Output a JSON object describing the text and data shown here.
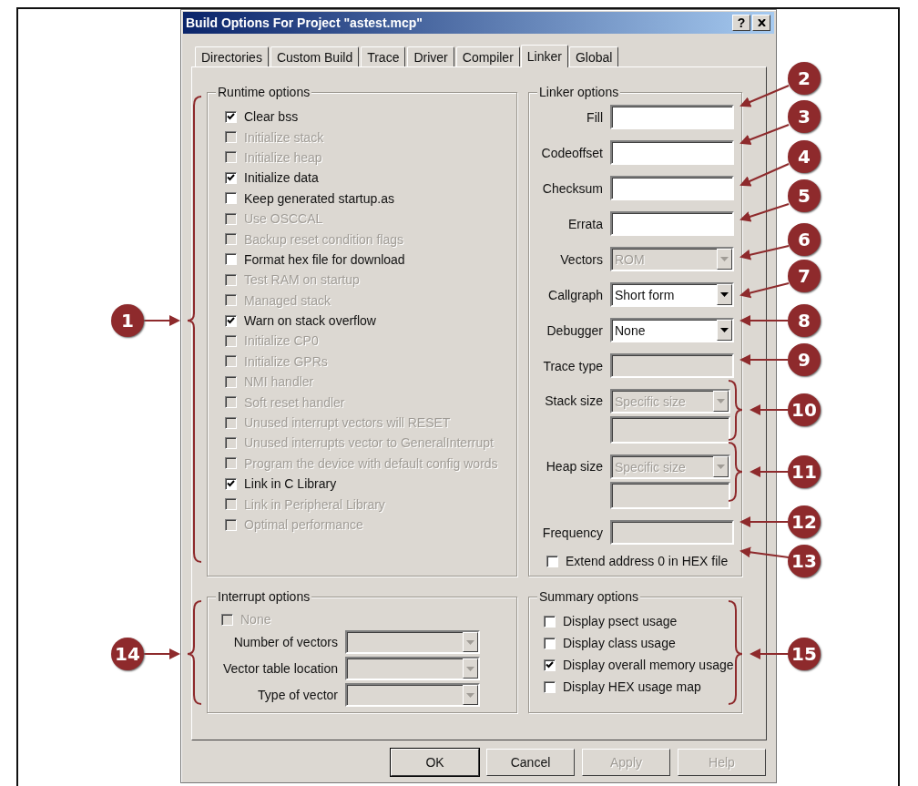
{
  "window": {
    "title": "Build Options For Project \"astest.mcp\"",
    "help_button": "?"
  },
  "tabs": [
    {
      "label": "Directories",
      "selected": false
    },
    {
      "label": "Custom Build",
      "selected": false
    },
    {
      "label": "Trace",
      "selected": false
    },
    {
      "label": "Driver",
      "selected": false
    },
    {
      "label": "Compiler",
      "selected": false
    },
    {
      "label": "Linker",
      "selected": true
    },
    {
      "label": "Global",
      "selected": false
    }
  ],
  "runtime_options": {
    "title": "Runtime options",
    "items": [
      {
        "label": "Clear bss",
        "checked": true,
        "disabled": false
      },
      {
        "label": "Initialize stack",
        "checked": false,
        "disabled": true
      },
      {
        "label": "Initialize heap",
        "checked": false,
        "disabled": true
      },
      {
        "label": "Initialize data",
        "checked": true,
        "disabled": false
      },
      {
        "label": "Keep generated startup.as",
        "checked": false,
        "disabled": false
      },
      {
        "label": "Use OSCCAL",
        "checked": false,
        "disabled": true
      },
      {
        "label": "Backup reset condition flags",
        "checked": false,
        "disabled": true
      },
      {
        "label": "Format hex file for download",
        "checked": false,
        "disabled": false
      },
      {
        "label": "Test RAM on startup",
        "checked": false,
        "disabled": true
      },
      {
        "label": "Managed stack",
        "checked": false,
        "disabled": true
      },
      {
        "label": "Warn on stack overflow",
        "checked": true,
        "disabled": false
      },
      {
        "label": "Initialize CP0",
        "checked": false,
        "disabled": true
      },
      {
        "label": "Initialize GPRs",
        "checked": false,
        "disabled": true
      },
      {
        "label": "NMI handler",
        "checked": false,
        "disabled": true
      },
      {
        "label": "Soft reset handler",
        "checked": false,
        "disabled": true
      },
      {
        "label": "Unused interrupt vectors will RESET",
        "checked": false,
        "disabled": true
      },
      {
        "label": "Unused interrupts vector to GeneralInterrupt",
        "checked": false,
        "disabled": true
      },
      {
        "label": "Program the device with default config words",
        "checked": false,
        "disabled": true
      },
      {
        "label": "Link in C Library",
        "checked": true,
        "disabled": false
      },
      {
        "label": "Link in Peripheral Library",
        "checked": false,
        "disabled": true
      },
      {
        "label": "Optimal performance",
        "checked": false,
        "disabled": true
      }
    ]
  },
  "linker_options": {
    "title": "Linker options",
    "fields": [
      {
        "kind": "text",
        "label": "Fill",
        "disabled": false
      },
      {
        "kind": "text",
        "label": "Codeoffset",
        "disabled": false
      },
      {
        "kind": "text",
        "label": "Checksum",
        "disabled": false
      },
      {
        "kind": "text",
        "label": "Errata",
        "disabled": false
      },
      {
        "kind": "select",
        "label": "Vectors",
        "value": "ROM",
        "disabled": true
      },
      {
        "kind": "select",
        "label": "Callgraph",
        "value": "Short form",
        "disabled": false
      },
      {
        "kind": "select",
        "label": "Debugger",
        "value": "None",
        "disabled": false
      },
      {
        "kind": "text",
        "label": "Trace type",
        "disabled": true
      },
      {
        "kind": "select_text",
        "label": "Stack size",
        "value": "Specific size",
        "disabled": true
      },
      {
        "kind": "select_text",
        "label": "Heap size",
        "value": "Specific size",
        "disabled": true
      },
      {
        "kind": "text",
        "label": "Frequency",
        "disabled": true
      }
    ],
    "checkbox": {
      "label": "Extend address 0 in HEX file",
      "checked": false,
      "disabled": false
    }
  },
  "interrupt_options": {
    "title": "Interrupt options",
    "checkbox": {
      "label": "None",
      "checked": false,
      "disabled": true
    },
    "fields": [
      {
        "label": "Number of vectors",
        "disabled": true
      },
      {
        "label": "Vector table location",
        "disabled": true
      },
      {
        "label": "Type of vector",
        "disabled": true
      }
    ]
  },
  "summary_options": {
    "title": "Summary options",
    "items": [
      {
        "label": "Display psect usage",
        "checked": false,
        "disabled": false
      },
      {
        "label": "Display class usage",
        "checked": false,
        "disabled": false
      },
      {
        "label": "Display overall memory usage",
        "checked": true,
        "disabled": false
      },
      {
        "label": "Display HEX usage map",
        "checked": false,
        "disabled": false
      }
    ]
  },
  "buttons": [
    {
      "label": "OK",
      "disabled": false,
      "default": true
    },
    {
      "label": "Cancel",
      "disabled": false,
      "default": false
    },
    {
      "label": "Apply",
      "disabled": true,
      "default": false
    },
    {
      "label": "Help",
      "disabled": true,
      "default": false
    }
  ],
  "callouts": [
    {
      "number": "2",
      "kind": "arrow"
    },
    {
      "number": "3",
      "kind": "arrow"
    },
    {
      "number": "4",
      "kind": "arrow"
    },
    {
      "number": "5",
      "kind": "arrow"
    },
    {
      "number": "6",
      "kind": "arrow"
    },
    {
      "number": "7",
      "kind": "arrow"
    },
    {
      "number": "1",
      "kind": "brace"
    },
    {
      "number": "8",
      "kind": "arrow"
    },
    {
      "number": "9",
      "kind": "arrow"
    },
    {
      "number": "10",
      "kind": "brace"
    },
    {
      "number": "11",
      "kind": "brace"
    },
    {
      "number": "12",
      "kind": "arrow"
    },
    {
      "number": "13",
      "kind": "arrow"
    },
    {
      "number": "14",
      "kind": "brace"
    },
    {
      "number": "15",
      "kind": "brace"
    }
  ]
}
